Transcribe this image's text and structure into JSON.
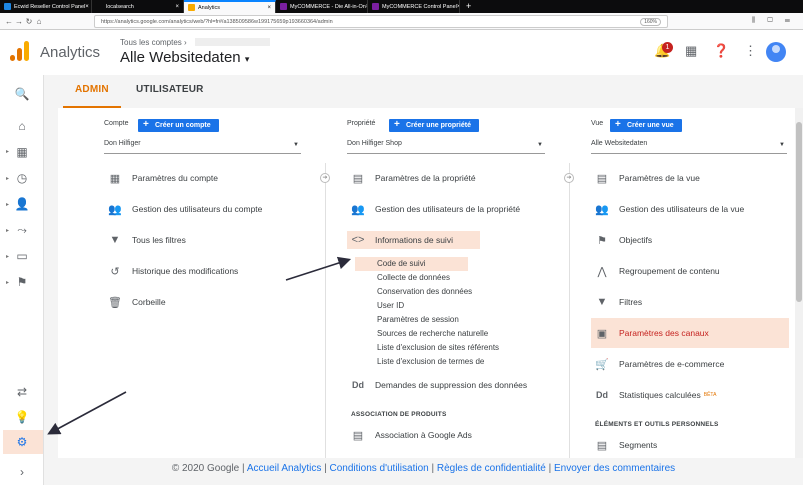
{
  "browser": {
    "tabs": [
      {
        "label": "Ecwid Reseller Control Panel",
        "color": "#1e88e5",
        "active": false
      },
      {
        "label": "localsearch",
        "color": "#0c0c0d",
        "active": false
      },
      {
        "label": "Analytics",
        "color": "#f9ab00",
        "active": true
      },
      {
        "label": "MyCOMMERCE - Die All-in-On",
        "color": "#7b1fa2",
        "active": false
      },
      {
        "label": "MyCOMMERCE Control Panel",
        "color": "#7b1fa2",
        "active": false
      }
    ],
    "new_tab": "+",
    "url": "https://analytics.google.com/analytics/web/?hl=fr#/a138509586w199175659p193660364/admin",
    "zoom": "160%"
  },
  "header": {
    "app_title": "Analytics",
    "account_path": "Tous les comptes",
    "account_name": "Alle Websitedaten",
    "notification_count": "1"
  },
  "tabs": {
    "admin": "ADMIN",
    "user": "UTILISATEUR"
  },
  "account_col": {
    "heading": "Compte",
    "create_button": "Créer un compte",
    "selected": "Don Hilfiger",
    "items": [
      {
        "label": "Paramètres du compte",
        "icon": "building-icon"
      },
      {
        "label": "Gestion des utilisateurs du compte",
        "icon": "users-icon"
      },
      {
        "label": "Tous les filtres",
        "icon": "filter-icon"
      },
      {
        "label": "Historique des modifications",
        "icon": "history-icon"
      },
      {
        "label": "Corbeille",
        "icon": "trash-icon"
      }
    ]
  },
  "property_col": {
    "heading": "Propriété",
    "create_button": "Créer une propriété",
    "selected": "Don Hilfiger Shop",
    "items": [
      {
        "label": "Paramètres de la propriété",
        "icon": "document-icon"
      },
      {
        "label": "Gestion des utilisateurs de la propriété",
        "icon": "users-icon"
      },
      {
        "label": "Informations de suivi",
        "icon": "code-icon"
      }
    ],
    "tracking_sub": [
      "Code de suivi",
      "Collecte de données",
      "Conservation des données",
      "User ID",
      "Paramètres de session",
      "Sources de recherche naturelle",
      "Liste d'exclusion de sites référents",
      "Liste d'exclusion de termes de"
    ],
    "deletion_item": "Demandes de suppression des données",
    "deletion_icon_text": "Dd",
    "product_section": "ASSOCIATION DE PRODUITS",
    "ads_link": "Association à Google Ads"
  },
  "view_col": {
    "heading": "Vue",
    "create_button": "Créer une vue",
    "selected": "Alle Websitedaten",
    "items": [
      {
        "label": "Paramètres de la vue",
        "icon": "document-icon"
      },
      {
        "label": "Gestion des utilisateurs de la vue",
        "icon": "users-icon"
      },
      {
        "label": "Objectifs",
        "icon": "flag-icon"
      },
      {
        "label": "Regroupement de contenu",
        "icon": "grouping-icon"
      },
      {
        "label": "Filtres",
        "icon": "filter-icon"
      },
      {
        "label": "Paramètres des canaux",
        "icon": "channel-icon"
      },
      {
        "label": "Paramètres de e-commerce",
        "icon": "cart-icon"
      }
    ],
    "calc_metrics": "Statistiques calculées",
    "calc_icon_text": "Dd",
    "beta": "BÊTA",
    "tools_section": "ÉLÉMENTS ET OUTILS PERSONNELS",
    "segments": "Segments"
  },
  "footer": {
    "copyright": "© 2020 Google | ",
    "home": "Accueil Analytics",
    "terms": "Conditions d'utilisation",
    "privacy": "Règles de confidentialité",
    "feedback": "Envoyer des commentaires",
    "sep": " | "
  },
  "colors": {
    "accent": "#e37400",
    "primary_button": "#1a73e8",
    "highlight": "#fbe3d6"
  }
}
